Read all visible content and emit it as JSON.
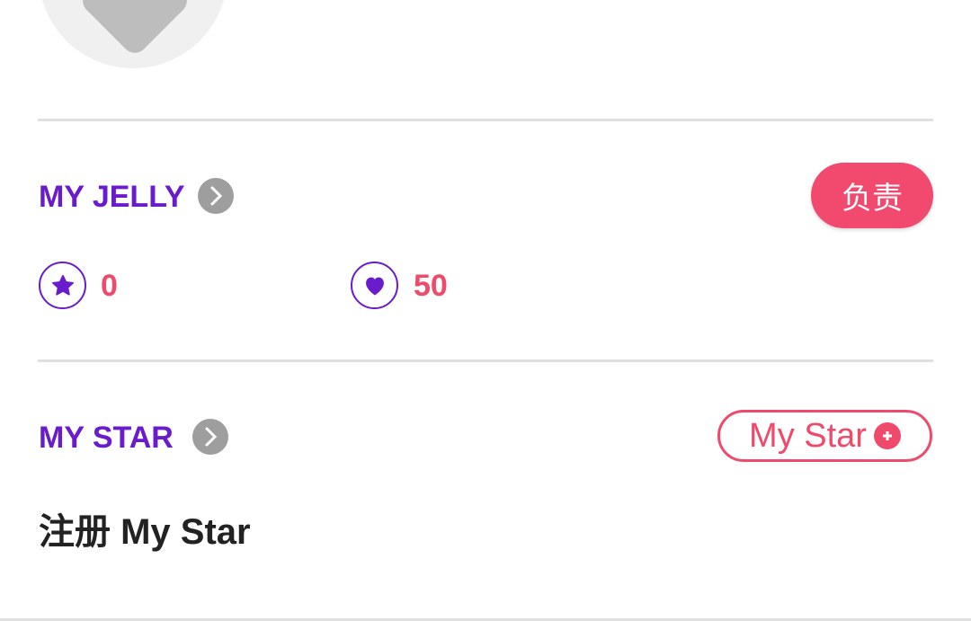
{
  "jelly": {
    "title": "MY JELLY",
    "charge_button": "负责",
    "star_count": "0",
    "heart_count": "50"
  },
  "star": {
    "title": "MY STAR",
    "add_button": "My Star",
    "register_text": "注册 My Star"
  },
  "colors": {
    "purple": "#6a1bcc",
    "pink": "#ef4a6c",
    "gray": "#9e9e9e"
  }
}
